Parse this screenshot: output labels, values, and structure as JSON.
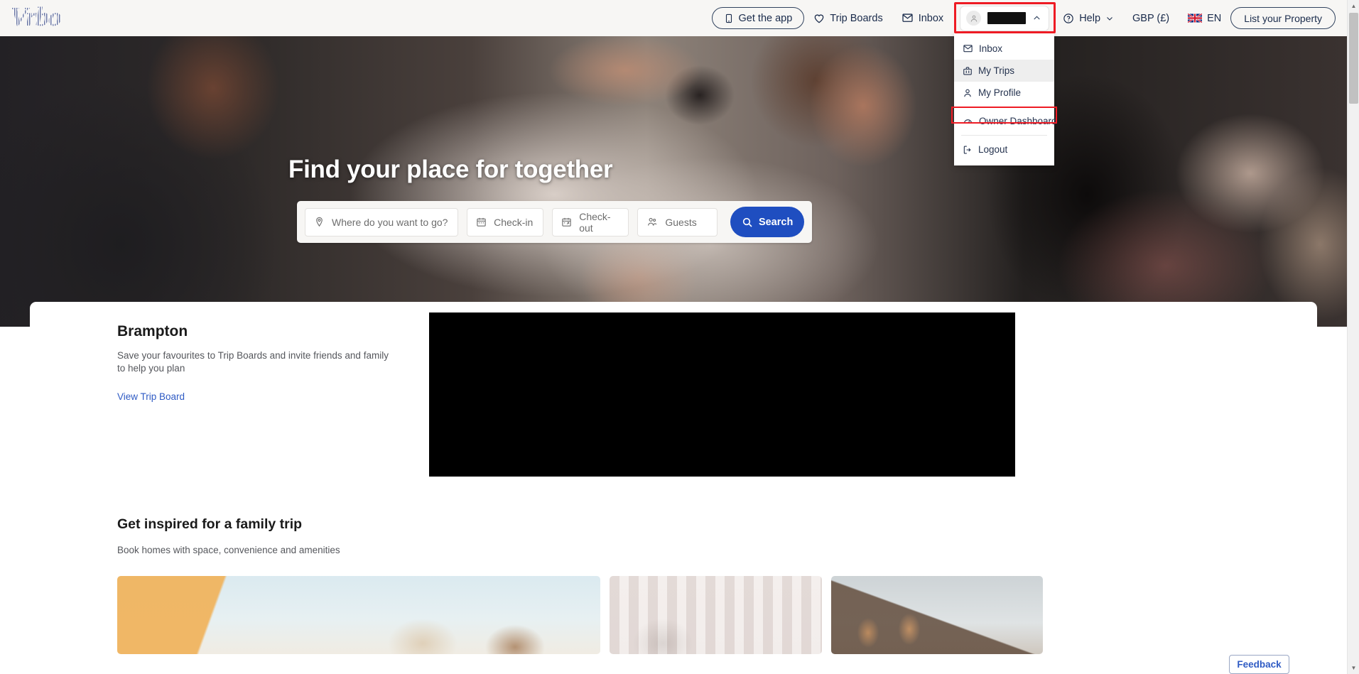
{
  "brand": {
    "logo_text": "Vrbo"
  },
  "header": {
    "nav": [
      {
        "label": "Get the app",
        "icon": "mobile-app-icon",
        "style": "pill"
      },
      {
        "label": "Trip Boards",
        "icon": "heart-icon",
        "style": "plain"
      },
      {
        "label": "Inbox",
        "icon": "envelope-icon",
        "style": "plain"
      }
    ],
    "account": {
      "name_redacted": true,
      "avatar_icon": "user-avatar-icon",
      "chevron": "chevron-up-icon",
      "highlighted": true
    },
    "help": {
      "label": "Help",
      "icon": "question-circle-icon",
      "chevron": "chevron-down-icon"
    },
    "currency": {
      "label": "GBP (£)"
    },
    "language": {
      "label": "EN",
      "flag": "uk-flag-icon"
    },
    "list_property": {
      "label": "List your Property"
    }
  },
  "account_menu": {
    "items": [
      {
        "label": "Inbox",
        "icon": "envelope-icon",
        "hovered": false,
        "highlighted": false
      },
      {
        "label": "My Trips",
        "icon": "suitcase-icon",
        "hovered": true,
        "highlighted": false
      },
      {
        "label": "My Profile",
        "icon": "person-icon",
        "hovered": false,
        "highlighted": false
      },
      {
        "label": "Owner Dashboard",
        "icon": "speedometer-icon",
        "hovered": false,
        "highlighted": true
      },
      {
        "label": "Logout",
        "icon": "logout-arrow-icon",
        "hovered": false,
        "highlighted": false
      }
    ]
  },
  "hero": {
    "title": "Find your place for together"
  },
  "search": {
    "destination_placeholder": "Where do you want to go?",
    "checkin_placeholder": "Check-in",
    "checkout_placeholder": "Check-out",
    "guests_placeholder": "Guests",
    "destination_value": "",
    "checkin_value": "",
    "checkout_value": "",
    "guests_value": "",
    "search_button": "Search",
    "icons": {
      "destination": "map-pin-icon",
      "checkin": "calendar-icon",
      "checkout": "calendar-arrow-icon",
      "guests": "guests-icon",
      "search": "magnifier-icon"
    }
  },
  "trip_board": {
    "title": "Brampton",
    "description": "Save your favourites to Trip Boards and invite friends and family to help you plan",
    "link_label": "View Trip Board"
  },
  "inspire": {
    "title": "Get inspired for a family trip",
    "subtitle": "Book homes with space, convenience and amenities",
    "cards": [
      {
        "alt": "row-of-houses-photo"
      },
      {
        "alt": "dog-on-porch-photo"
      },
      {
        "alt": "family-playing-outside-photo"
      }
    ]
  },
  "feedback": {
    "label": "Feedback"
  },
  "colors": {
    "header_bg": "#f7f6f4",
    "primary_blue": "#1f4ec0",
    "link_blue": "#2f5bc4",
    "highlight_red": "#ee1b24",
    "text_dark": "#1a2b4b",
    "logo_blue": "#7f8ab0"
  }
}
